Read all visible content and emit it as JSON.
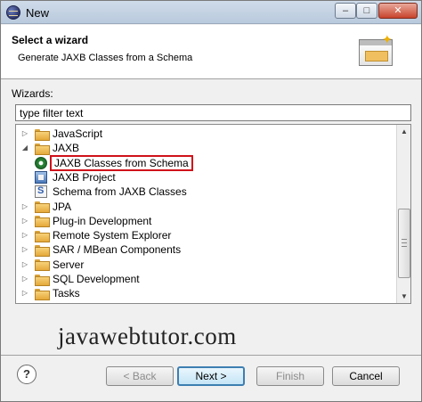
{
  "window": {
    "title": "New",
    "controls": {
      "minimize": "–",
      "maximize": "□",
      "close": "✕"
    }
  },
  "header": {
    "title": "Select a wizard",
    "description": "Generate JAXB Classes from a Schema"
  },
  "wizards_label": "Wizards:",
  "filter": {
    "value": "type filter text"
  },
  "tree": {
    "items": [
      {
        "label": "JavaScript",
        "type": "folder",
        "expanded": false,
        "level": 0
      },
      {
        "label": "JAXB",
        "type": "folder",
        "expanded": true,
        "level": 0
      },
      {
        "label": "JAXB Classes from Schema",
        "type": "wizard",
        "icon": "gear-icon",
        "selected": true,
        "level": 1
      },
      {
        "label": "JAXB Project",
        "type": "wizard",
        "icon": "project-icon",
        "level": 1
      },
      {
        "label": "Schema from JAXB Classes",
        "type": "wizard",
        "icon": "schema-icon",
        "level": 1
      },
      {
        "label": "JPA",
        "type": "folder",
        "expanded": false,
        "level": 0
      },
      {
        "label": "Plug-in Development",
        "type": "folder",
        "expanded": false,
        "level": 0
      },
      {
        "label": "Remote System Explorer",
        "type": "folder",
        "expanded": false,
        "level": 0
      },
      {
        "label": "SAR / MBean Components",
        "type": "folder",
        "expanded": false,
        "level": 0
      },
      {
        "label": "Server",
        "type": "folder",
        "expanded": false,
        "level": 0
      },
      {
        "label": "SQL Development",
        "type": "folder",
        "expanded": false,
        "level": 0
      },
      {
        "label": "Tasks",
        "type": "folder",
        "expanded": false,
        "level": 0
      }
    ]
  },
  "watermark": "javawebtutor.com",
  "buttons": {
    "help": "?",
    "back": "< Back",
    "next": "Next >",
    "finish": "Finish",
    "cancel": "Cancel"
  }
}
